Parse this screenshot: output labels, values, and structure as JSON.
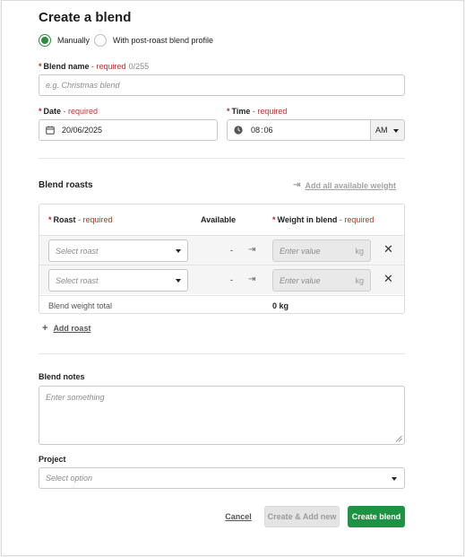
{
  "title": "Create a blend",
  "mode": {
    "options": [
      "Manually",
      "With post-roast blend profile"
    ],
    "selected": 0
  },
  "blend_name": {
    "label": "Blend name",
    "required": "- required",
    "count": "0/255",
    "placeholder": "e.g. Christmas blend"
  },
  "date": {
    "label": "Date",
    "required": "- required",
    "value": "20/06/2025",
    "icon": "calendar-icon"
  },
  "time": {
    "label": "Time",
    "required": "- required",
    "hour": "08",
    "sep": ":",
    "minute": "06",
    "ampm": "AM",
    "icon": "clock-icon"
  },
  "roasts_section": {
    "title": "Blend roasts",
    "add_all_label": "Add all available weight",
    "headers": {
      "roast": "Roast",
      "roast_required": "- required",
      "available": "Available",
      "weight": "Weight in blend",
      "weight_required": "- required"
    },
    "rows": [
      {
        "roast_placeholder": "Select roast",
        "available": "-",
        "weight_placeholder": "Enter value",
        "unit": "kg"
      },
      {
        "roast_placeholder": "Select roast",
        "available": "-",
        "weight_placeholder": "Enter value",
        "unit": "kg"
      }
    ],
    "total_label": "Blend weight total",
    "total_value": "0 kg",
    "add_roast_label": "Add roast"
  },
  "notes": {
    "label": "Blend notes",
    "placeholder": "Enter something"
  },
  "project": {
    "label": "Project",
    "placeholder": "Select option"
  },
  "buttons": {
    "cancel": "Cancel",
    "create_add_new": "Create & Add new",
    "create": "Create blend"
  },
  "colors": {
    "primary": "#1e9243",
    "required": "#b03a2e",
    "radio": "#2e8b3e"
  }
}
